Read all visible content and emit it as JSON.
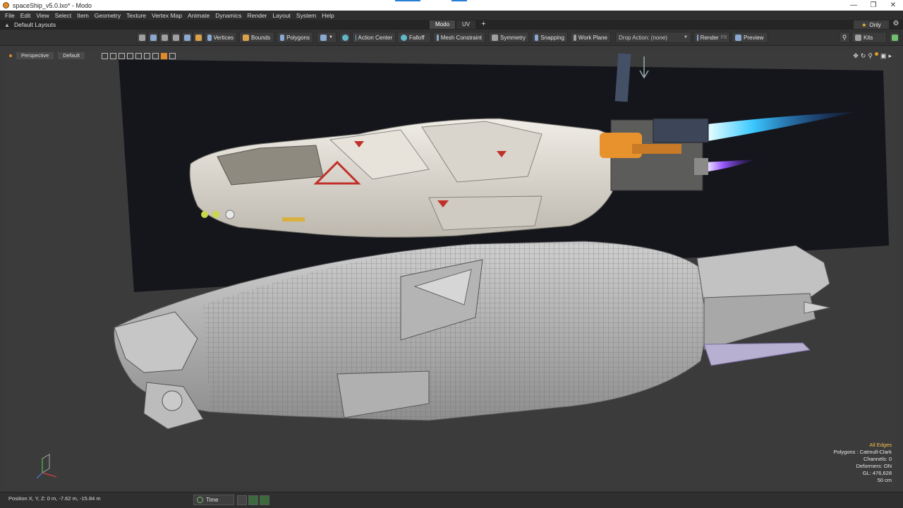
{
  "window": {
    "title": "spaceShip_v5.0.lxo* - Modo",
    "controls": [
      "—",
      "❐",
      "✕"
    ]
  },
  "menu": [
    "File",
    "Edit",
    "View",
    "Select",
    "Item",
    "Geometry",
    "Texture",
    "Vertex Map",
    "Animate",
    "Dynamics",
    "Render",
    "Layout",
    "System",
    "Help"
  ],
  "layout": {
    "name": "Default Layouts",
    "tabs": [
      "Modo",
      "UV"
    ],
    "add_tab": "+",
    "only_label": "Only"
  },
  "toolbar": {
    "vertices": "Vertices",
    "bounds": "Bounds",
    "polygons": "Polygons",
    "action_center": "Action Center",
    "falloff": "Falloff",
    "mesh_constraint": "Mesh Constraint",
    "symmetry": "Symmetry",
    "snapping": "Snapping",
    "work_plane": "Work Plane",
    "drop_action": "Drop Action: (none)",
    "render": "Render",
    "render_hotkey": "F9",
    "preview": "Preview",
    "kits": "Kits"
  },
  "viewport": {
    "view_mode": "Perspective",
    "shading": "Default",
    "stats": {
      "edges": "All Edges",
      "polygons": "Polygons : Catmull-Clark",
      "channels": "Channels: 0",
      "deformers": "Deformers: ON",
      "gl": "GL: 476,628",
      "scale": "50 cm"
    }
  },
  "status": {
    "position": "Position X, Y, Z:   0 m, -7.62 m, -15.84 m",
    "time_label": "Time"
  },
  "colors": {
    "accent": "#e08a2a",
    "background": "#3b3b3b",
    "hull": "#dedad2",
    "thruster_flame": "#3ac8ff",
    "thruster_flame2": "#9a5cff",
    "engine_orange": "#e8922e"
  }
}
